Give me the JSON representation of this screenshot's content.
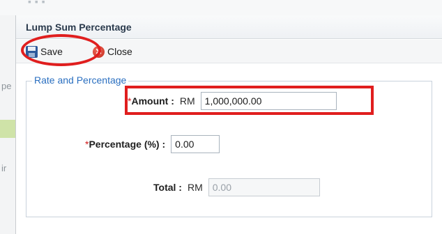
{
  "dialog": {
    "title": "Lump Sum Percentage"
  },
  "toolbar": {
    "save_label": "Save",
    "close_label": "Close",
    "save_icon": "floppy-disk-icon",
    "close_icon": "close-circle-icon"
  },
  "form": {
    "legend": "Rate and Percentage",
    "required_mark": "*",
    "amount": {
      "label": "Amount :",
      "prefix": "RM",
      "value": "1,000,000.00"
    },
    "percentage": {
      "label": "Percentage (%) :",
      "value": "0.00"
    },
    "total": {
      "label": "Total :",
      "prefix": "RM",
      "value": "0.00"
    }
  },
  "background": {
    "fragment_1": "pe",
    "fragment_2": "ir"
  },
  "colors": {
    "annotation_red": "#e01e1e",
    "legend_blue": "#2a6fc0",
    "required_red": "#d21a1a"
  }
}
